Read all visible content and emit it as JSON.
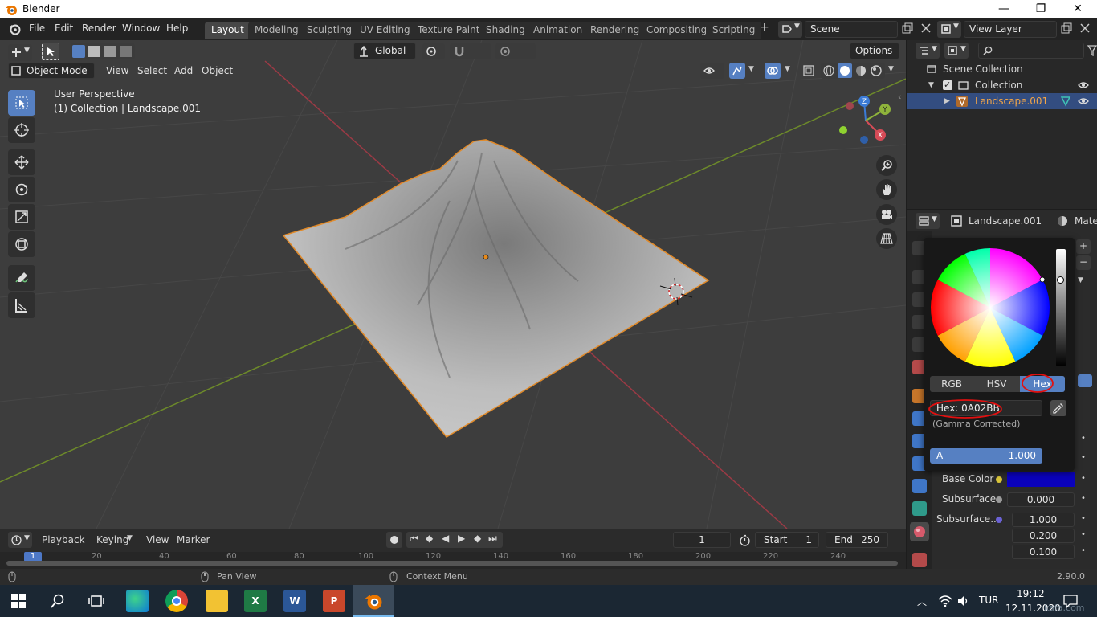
{
  "window": {
    "title": "Blender",
    "controls": [
      "—",
      "❐",
      "✕"
    ]
  },
  "menubar": {
    "items": [
      "File",
      "Edit",
      "Render",
      "Window",
      "Help"
    ],
    "workspaces": [
      "Layout",
      "Modeling",
      "Sculpting",
      "UV Editing",
      "Texture Paint",
      "Shading",
      "Animation",
      "Rendering",
      "Compositing",
      "Scripting"
    ],
    "active_workspace": "Layout",
    "add_tab": "+",
    "scene": "Scene",
    "view_layer": "View Layer"
  },
  "viewport": {
    "mode": "Object Mode",
    "menus": [
      "View",
      "Select",
      "Add",
      "Object"
    ],
    "orientation": "Global",
    "options": "Options",
    "perspective_label": "User Perspective",
    "collection_label": "(1) Collection | Landscape.001",
    "gizmo": {
      "z": "Z",
      "y": "Y",
      "x": "X"
    }
  },
  "outliner": {
    "search_placeholder": "",
    "rows": [
      {
        "label": "Scene Collection"
      },
      {
        "label": "Collection"
      },
      {
        "label": "Landscape.001"
      }
    ]
  },
  "properties": {
    "object_name": "Landscape.001",
    "tab_label": "Mater",
    "rows": [
      {
        "label": "Base Color",
        "value": ""
      },
      {
        "label": "Subsurface",
        "value": "0.000"
      },
      {
        "label": "Subsurface...",
        "value": "1.000"
      }
    ],
    "extra_values": [
      "0.200",
      "0.100"
    ],
    "base_color": "#0a02bb"
  },
  "color_picker": {
    "modes": [
      "RGB",
      "HSV",
      "Hex"
    ],
    "active_mode": "Hex",
    "hex_field": "Hex: 0A02BB",
    "gamma_note": "(Gamma Corrected)",
    "alpha_label": "A",
    "alpha_value": "1.000"
  },
  "timeline": {
    "menus": [
      "Playback",
      "Keying",
      "View",
      "Marker"
    ],
    "current_frame": "1",
    "start_label": "Start",
    "start_value": "1",
    "end_label": "End",
    "end_value": "250",
    "ruler": [
      "1",
      "20",
      "40",
      "60",
      "80",
      "100",
      "120",
      "140",
      "160",
      "180",
      "200",
      "220",
      "240"
    ]
  },
  "statusbar": {
    "pan_view": "Pan View",
    "context_menu": "Context Menu",
    "version": "2.90.0"
  },
  "taskbar": {
    "language": "TUR",
    "time": "19:12",
    "date": "12.11.2020",
    "watermark": "kafa.com"
  }
}
